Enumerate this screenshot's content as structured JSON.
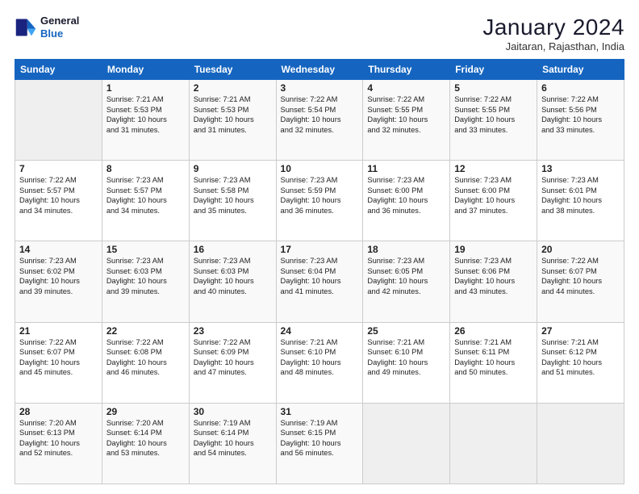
{
  "header": {
    "logo_general": "General",
    "logo_blue": "Blue",
    "month_title": "January 2024",
    "subtitle": "Jaitaran, Rajasthan, India"
  },
  "weekdays": [
    "Sunday",
    "Monday",
    "Tuesday",
    "Wednesday",
    "Thursday",
    "Friday",
    "Saturday"
  ],
  "weeks": [
    [
      {
        "day": "",
        "info": ""
      },
      {
        "day": "1",
        "info": "Sunrise: 7:21 AM\nSunset: 5:53 PM\nDaylight: 10 hours\nand 31 minutes."
      },
      {
        "day": "2",
        "info": "Sunrise: 7:21 AM\nSunset: 5:53 PM\nDaylight: 10 hours\nand 31 minutes."
      },
      {
        "day": "3",
        "info": "Sunrise: 7:22 AM\nSunset: 5:54 PM\nDaylight: 10 hours\nand 32 minutes."
      },
      {
        "day": "4",
        "info": "Sunrise: 7:22 AM\nSunset: 5:55 PM\nDaylight: 10 hours\nand 32 minutes."
      },
      {
        "day": "5",
        "info": "Sunrise: 7:22 AM\nSunset: 5:55 PM\nDaylight: 10 hours\nand 33 minutes."
      },
      {
        "day": "6",
        "info": "Sunrise: 7:22 AM\nSunset: 5:56 PM\nDaylight: 10 hours\nand 33 minutes."
      }
    ],
    [
      {
        "day": "7",
        "info": "Sunrise: 7:22 AM\nSunset: 5:57 PM\nDaylight: 10 hours\nand 34 minutes."
      },
      {
        "day": "8",
        "info": "Sunrise: 7:23 AM\nSunset: 5:57 PM\nDaylight: 10 hours\nand 34 minutes."
      },
      {
        "day": "9",
        "info": "Sunrise: 7:23 AM\nSunset: 5:58 PM\nDaylight: 10 hours\nand 35 minutes."
      },
      {
        "day": "10",
        "info": "Sunrise: 7:23 AM\nSunset: 5:59 PM\nDaylight: 10 hours\nand 36 minutes."
      },
      {
        "day": "11",
        "info": "Sunrise: 7:23 AM\nSunset: 6:00 PM\nDaylight: 10 hours\nand 36 minutes."
      },
      {
        "day": "12",
        "info": "Sunrise: 7:23 AM\nSunset: 6:00 PM\nDaylight: 10 hours\nand 37 minutes."
      },
      {
        "day": "13",
        "info": "Sunrise: 7:23 AM\nSunset: 6:01 PM\nDaylight: 10 hours\nand 38 minutes."
      }
    ],
    [
      {
        "day": "14",
        "info": "Sunrise: 7:23 AM\nSunset: 6:02 PM\nDaylight: 10 hours\nand 39 minutes."
      },
      {
        "day": "15",
        "info": "Sunrise: 7:23 AM\nSunset: 6:03 PM\nDaylight: 10 hours\nand 39 minutes."
      },
      {
        "day": "16",
        "info": "Sunrise: 7:23 AM\nSunset: 6:03 PM\nDaylight: 10 hours\nand 40 minutes."
      },
      {
        "day": "17",
        "info": "Sunrise: 7:23 AM\nSunset: 6:04 PM\nDaylight: 10 hours\nand 41 minutes."
      },
      {
        "day": "18",
        "info": "Sunrise: 7:23 AM\nSunset: 6:05 PM\nDaylight: 10 hours\nand 42 minutes."
      },
      {
        "day": "19",
        "info": "Sunrise: 7:23 AM\nSunset: 6:06 PM\nDaylight: 10 hours\nand 43 minutes."
      },
      {
        "day": "20",
        "info": "Sunrise: 7:22 AM\nSunset: 6:07 PM\nDaylight: 10 hours\nand 44 minutes."
      }
    ],
    [
      {
        "day": "21",
        "info": "Sunrise: 7:22 AM\nSunset: 6:07 PM\nDaylight: 10 hours\nand 45 minutes."
      },
      {
        "day": "22",
        "info": "Sunrise: 7:22 AM\nSunset: 6:08 PM\nDaylight: 10 hours\nand 46 minutes."
      },
      {
        "day": "23",
        "info": "Sunrise: 7:22 AM\nSunset: 6:09 PM\nDaylight: 10 hours\nand 47 minutes."
      },
      {
        "day": "24",
        "info": "Sunrise: 7:21 AM\nSunset: 6:10 PM\nDaylight: 10 hours\nand 48 minutes."
      },
      {
        "day": "25",
        "info": "Sunrise: 7:21 AM\nSunset: 6:10 PM\nDaylight: 10 hours\nand 49 minutes."
      },
      {
        "day": "26",
        "info": "Sunrise: 7:21 AM\nSunset: 6:11 PM\nDaylight: 10 hours\nand 50 minutes."
      },
      {
        "day": "27",
        "info": "Sunrise: 7:21 AM\nSunset: 6:12 PM\nDaylight: 10 hours\nand 51 minutes."
      }
    ],
    [
      {
        "day": "28",
        "info": "Sunrise: 7:20 AM\nSunset: 6:13 PM\nDaylight: 10 hours\nand 52 minutes."
      },
      {
        "day": "29",
        "info": "Sunrise: 7:20 AM\nSunset: 6:14 PM\nDaylight: 10 hours\nand 53 minutes."
      },
      {
        "day": "30",
        "info": "Sunrise: 7:19 AM\nSunset: 6:14 PM\nDaylight: 10 hours\nand 54 minutes."
      },
      {
        "day": "31",
        "info": "Sunrise: 7:19 AM\nSunset: 6:15 PM\nDaylight: 10 hours\nand 56 minutes."
      },
      {
        "day": "",
        "info": ""
      },
      {
        "day": "",
        "info": ""
      },
      {
        "day": "",
        "info": ""
      }
    ]
  ]
}
